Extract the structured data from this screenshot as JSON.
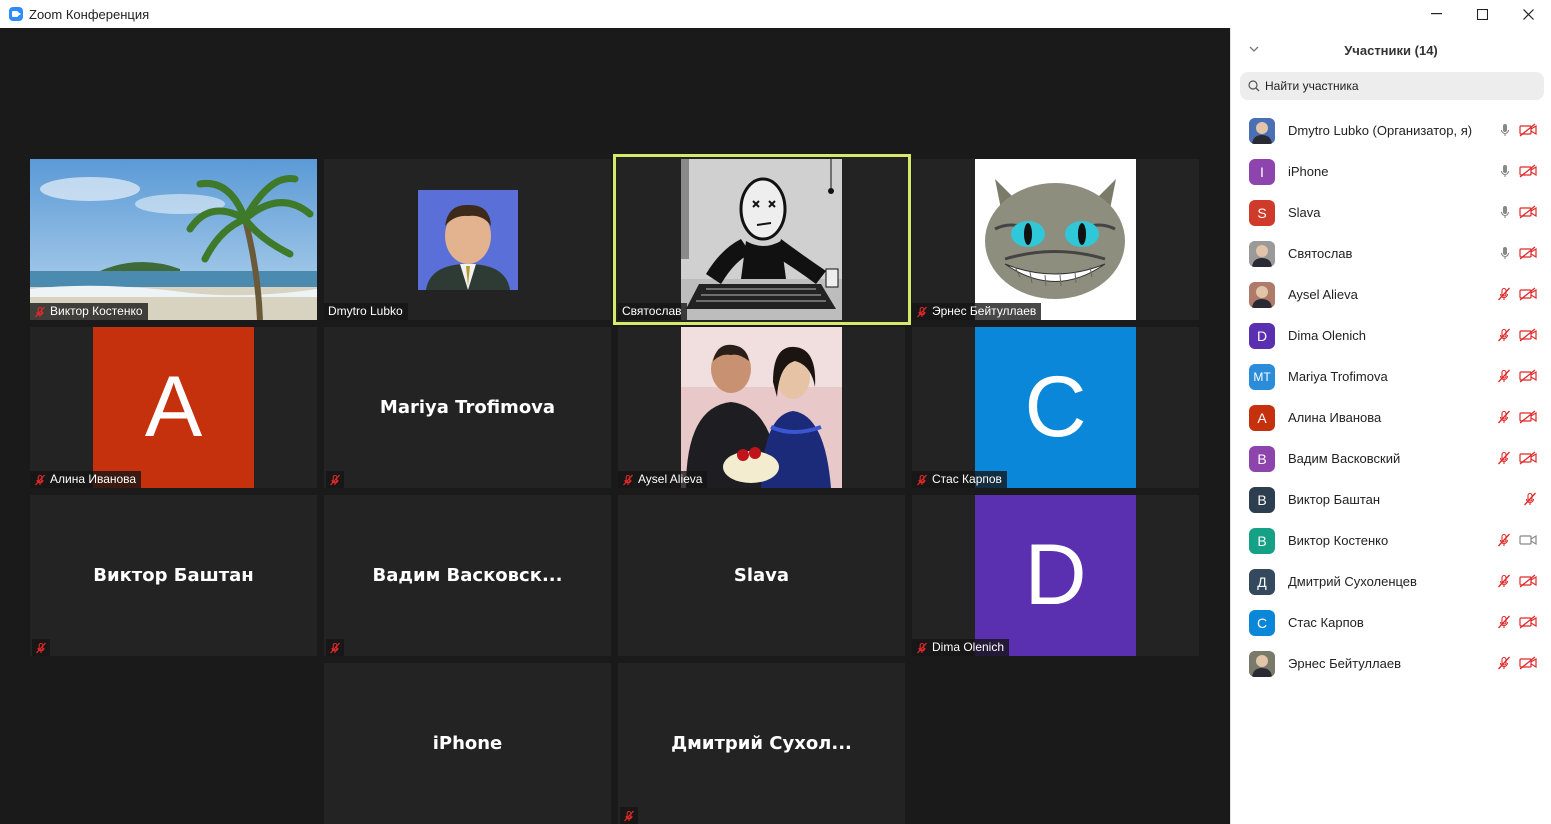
{
  "window": {
    "title": "Zoom Конференция",
    "minimize": "—",
    "maximize": "☐",
    "close": "✕"
  },
  "gallery": {
    "tiles": [
      {
        "name": "Виктор Костенко",
        "type": "video-beach",
        "muted": true
      },
      {
        "name": "Dmytro Lubko",
        "type": "video-portrait",
        "muted": false
      },
      {
        "name": "Святослав",
        "type": "video-sketch",
        "muted": false,
        "active_speaker": true
      },
      {
        "name": "Эрнес Бейтуллаев",
        "type": "video-cat",
        "muted": true
      },
      {
        "name": "Алина Иванова",
        "type": "avatar",
        "letter": "A",
        "color": "#C4310C",
        "muted": true
      },
      {
        "name": "Mariya Trofimova",
        "type": "name-only",
        "muted": true
      },
      {
        "name": "Aysel Alieva",
        "type": "video-couple",
        "muted": true
      },
      {
        "name": "Стас Карпов",
        "type": "avatar",
        "letter": "C",
        "color": "#0A87D8",
        "muted": true
      },
      {
        "name": "Виктор Баштан",
        "type": "name-only",
        "muted": true
      },
      {
        "name": "Вадим  Васковск...",
        "type": "name-only",
        "muted": true
      },
      {
        "name": "Slava",
        "type": "name-only",
        "muted": false
      },
      {
        "name": "Dima Olenich",
        "type": "avatar",
        "letter": "D",
        "color": "#5A2FB0",
        "muted": true
      },
      {
        "name": "iPhone",
        "type": "name-only",
        "muted": false
      },
      {
        "name": "Дмитрий  Сухол...",
        "type": "name-only",
        "muted": true
      }
    ]
  },
  "participants_panel": {
    "title": "Участники (14)",
    "search_placeholder": "Найти участника",
    "participants": [
      {
        "name": "Dmytro Lubko (Организатор, я)",
        "avatar": "photo",
        "color": "#4a6fb5",
        "mic": "on",
        "video": "off"
      },
      {
        "name": "iPhone",
        "avatar": "I",
        "color": "#8E44AD",
        "mic": "on",
        "video": "off"
      },
      {
        "name": "Slava",
        "avatar": "S",
        "color": "#D03A2B",
        "mic": "on",
        "video": "off"
      },
      {
        "name": "Святослав",
        "avatar": "photo",
        "color": "#9a9a9a",
        "mic": "on",
        "video": "off"
      },
      {
        "name": "Aysel Alieva",
        "avatar": "photo",
        "color": "#b07a6a",
        "mic": "muted",
        "video": "off"
      },
      {
        "name": "Dima Olenich",
        "avatar": "D",
        "color": "#5A2FB0",
        "mic": "muted",
        "video": "off"
      },
      {
        "name": "Mariya Trofimova",
        "avatar": "MT",
        "color": "#2B8CD9",
        "mic": "muted",
        "video": "off"
      },
      {
        "name": "Алина Иванова",
        "avatar": "A",
        "color": "#C4310C",
        "mic": "muted",
        "video": "off"
      },
      {
        "name": "Вадим Васковский",
        "avatar": "B",
        "color": "#8E44AD",
        "mic": "muted",
        "video": "off"
      },
      {
        "name": "Виктор Баштан",
        "avatar": "B",
        "color": "#2C3E50",
        "mic": "muted",
        "video": "none"
      },
      {
        "name": "Виктор Костенко",
        "avatar": "B",
        "color": "#16A085",
        "mic": "muted",
        "video": "on"
      },
      {
        "name": "Дмитрий Сухоленцев",
        "avatar": "Д",
        "color": "#34495E",
        "mic": "muted",
        "video": "off"
      },
      {
        "name": "Стас Карпов",
        "avatar": "C",
        "color": "#0A87D8",
        "mic": "muted",
        "video": "off"
      },
      {
        "name": "Эрнес Бейтуллаев",
        "avatar": "photo",
        "color": "#7a7a6a",
        "mic": "muted",
        "video": "off"
      }
    ]
  },
  "colors": {
    "accent": "#2D8CFF",
    "muted_red": "#E02828",
    "speaker_highlight": "#D8E96A"
  }
}
